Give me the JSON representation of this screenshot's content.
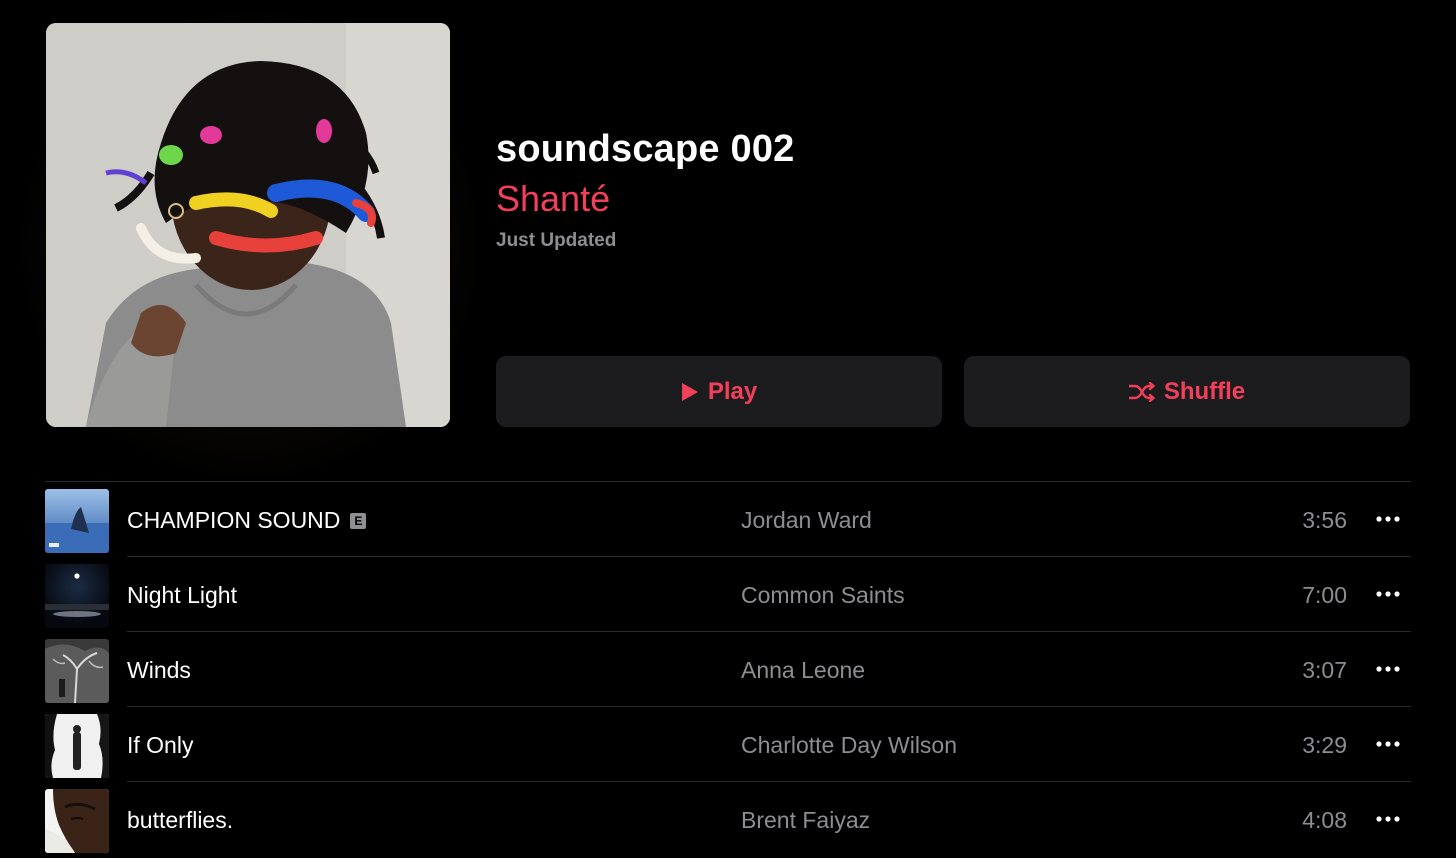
{
  "playlist": {
    "title": "soundscape 002",
    "curator": "Shanté",
    "updated": "Just Updated",
    "artwork_icon": "playlist-artwork-portrait"
  },
  "actions": {
    "play_label": "Play",
    "play_icon": "play-icon",
    "shuffle_label": "Shuffle",
    "shuffle_icon": "shuffle-icon"
  },
  "tracks": [
    {
      "title": "CHAMPION SOUND",
      "explicit": "E",
      "artist": "Jordan Ward",
      "duration": "3:56"
    },
    {
      "title": "Night Light",
      "explicit": "",
      "artist": "Common Saints",
      "duration": "7:00"
    },
    {
      "title": "Winds",
      "explicit": "",
      "artist": "Anna Leone",
      "duration": "3:07"
    },
    {
      "title": "If Only",
      "explicit": "",
      "artist": "Charlotte Day Wilson",
      "duration": "3:29"
    },
    {
      "title": "butterflies.",
      "explicit": "",
      "artist": "Brent Faiyaz",
      "duration": "4:08"
    }
  ],
  "colors": {
    "accent": "#f2405a",
    "background": "#000000",
    "button_bg": "#1c1c1e",
    "secondary_text": "#8d8d92"
  }
}
